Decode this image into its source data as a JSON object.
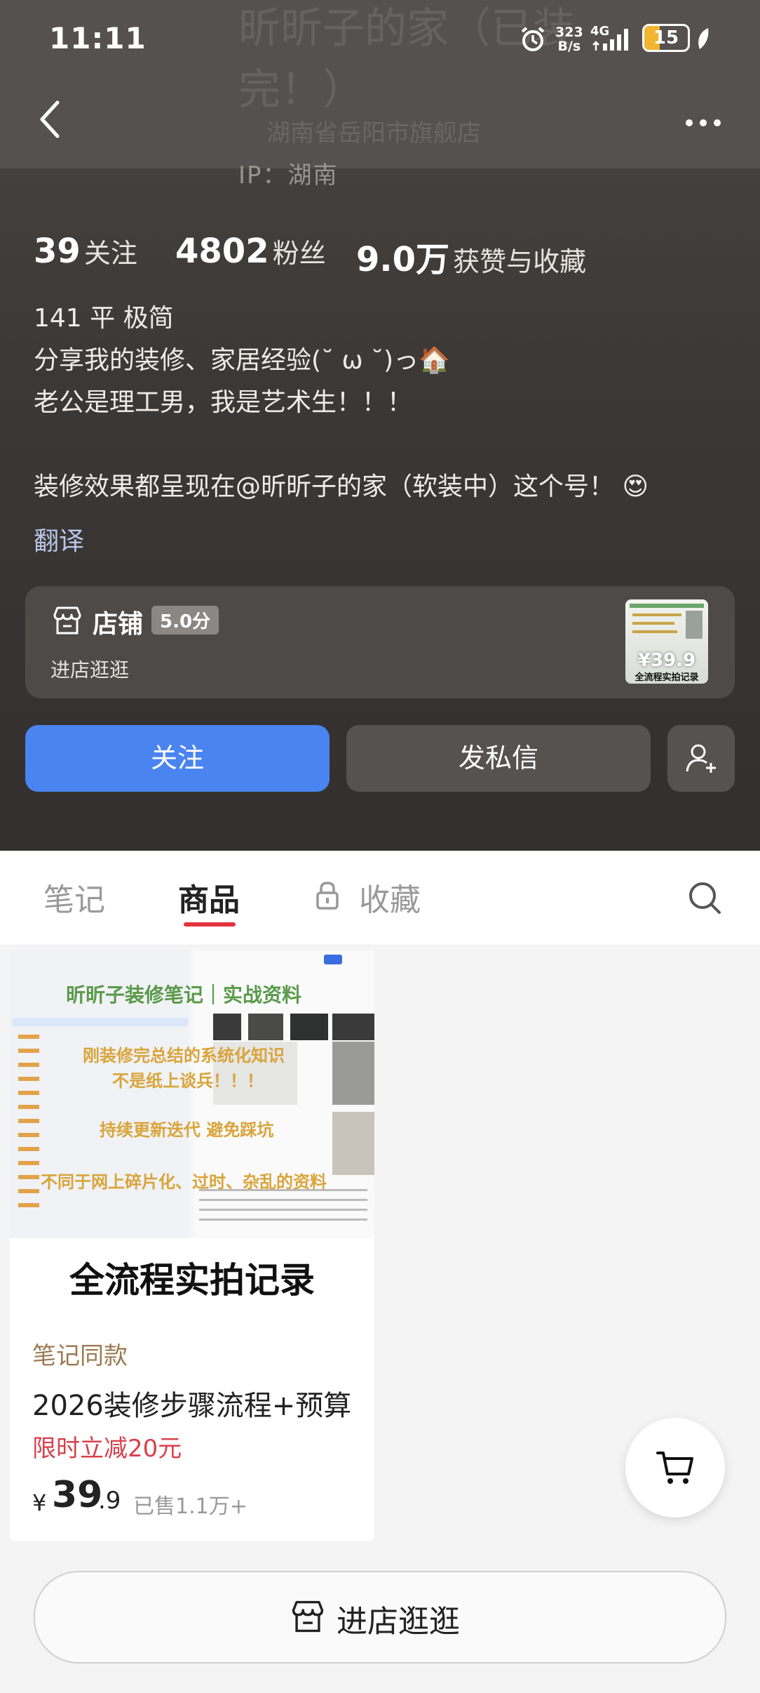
{
  "status_bar": {
    "time": "11:11",
    "net_speed_value": "323",
    "net_speed_unit": "B/s",
    "network": "4G",
    "battery": "15"
  },
  "profile": {
    "faded_name": "昕昕子的家（已装",
    "faded_name_line2": "完！）",
    "faded_subtitle": "湖南省岳阳市旗舰店",
    "ip_location": "IP：湖南",
    "stats": [
      {
        "value": "39",
        "label": "关注"
      },
      {
        "value": "4802",
        "label": "粉丝"
      },
      {
        "value": "9.0万",
        "label": "获赞与收藏"
      }
    ],
    "bio_lines": [
      "141 平 极简",
      "分享我的装修、家居经验(˘ ω ˘)っ🏠",
      "老公是理工男，我是艺术生！！！",
      "",
      "装修效果都呈现在@昕昕子的家（软装中）这个号！ 😍"
    ],
    "translate": "翻译"
  },
  "store_card": {
    "label": "店铺",
    "rating": "5.0分",
    "enter": "进店逛逛",
    "thumb_price": "¥39.9",
    "thumb_caption": "全流程实拍记录"
  },
  "actions": {
    "follow": "关注",
    "message": "发私信"
  },
  "tabs": [
    {
      "label": "笔记"
    },
    {
      "label": "商品"
    },
    {
      "label": "收藏"
    }
  ],
  "product": {
    "image_texts": [
      "昕昕子装修笔记｜实战资料",
      "刚装修完总结的系统化知识",
      "不是纸上谈兵！！！",
      "持续更新迭代 避免踩坑",
      "不同于网上碎片化、过时、杂乱的资料"
    ],
    "banner": "全流程实拍记录",
    "same_note": "笔记同款",
    "title": "2026装修步骤流程+预算",
    "promo": "限时立减20元",
    "price_symbol": "¥",
    "price_int": "39",
    "price_dec": ".9",
    "sold": "已售1.1万+"
  },
  "bottom": {
    "enter_store": "进店逛逛"
  },
  "colors": {
    "accent_blue": "#4a84f0",
    "tab_underline": "#e4333d",
    "promo_red": "#d9404a",
    "note_gold": "#9b7a52"
  }
}
